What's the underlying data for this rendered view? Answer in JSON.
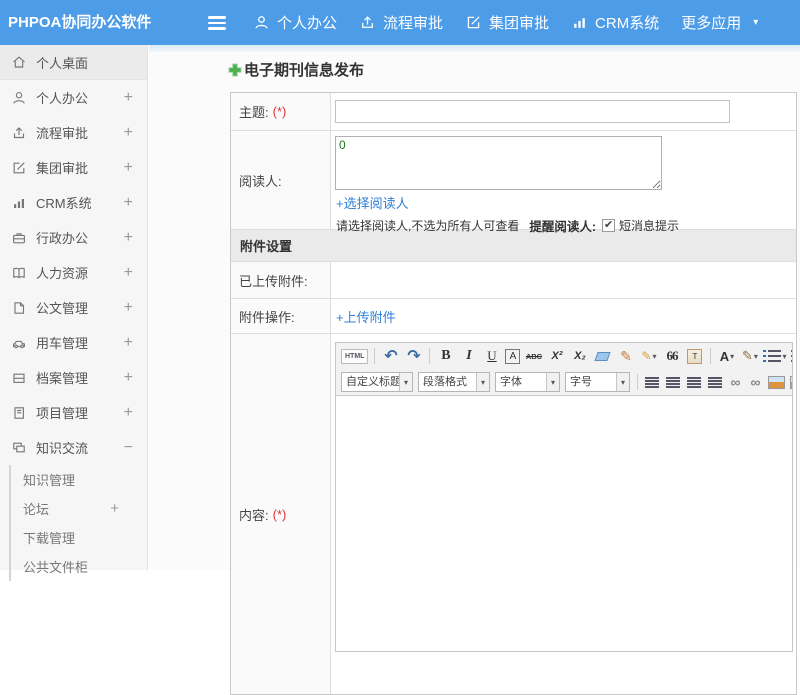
{
  "header": {
    "brand": "PHPOA协同办公软件",
    "nav": [
      {
        "label": "个人办公"
      },
      {
        "label": "流程审批"
      },
      {
        "label": "集团审批"
      },
      {
        "label": "CRM系统"
      },
      {
        "label": "更多应用"
      }
    ],
    "caret": "▾"
  },
  "sidebar": {
    "items": [
      {
        "label": "个人桌面",
        "expander": ""
      },
      {
        "label": "个人办公",
        "expander": "+"
      },
      {
        "label": "流程审批",
        "expander": "+"
      },
      {
        "label": "集团审批",
        "expander": "+"
      },
      {
        "label": "CRM系统",
        "expander": "+"
      },
      {
        "label": "行政办公",
        "expander": "+"
      },
      {
        "label": "人力资源",
        "expander": "+"
      },
      {
        "label": "公文管理",
        "expander": "+"
      },
      {
        "label": "用车管理",
        "expander": "+"
      },
      {
        "label": "档案管理",
        "expander": "+"
      },
      {
        "label": "项目管理",
        "expander": "+"
      },
      {
        "label": "知识交流",
        "expander": "−"
      }
    ],
    "subitems": [
      {
        "label": "知识管理",
        "expander": ""
      },
      {
        "label": "论坛",
        "expander": "+"
      },
      {
        "label": "下载管理",
        "expander": ""
      },
      {
        "label": "公共文件柜",
        "expander": ""
      }
    ]
  },
  "form": {
    "title": "电子期刊信息发布",
    "subject_label": "主题:",
    "required_mark": "(*)",
    "readers_label": "阅读人:",
    "readers_value": "0",
    "select_readers_link": "+选择阅读人",
    "readers_note": "请选择阅读人,不选为所有人可查看",
    "remind_label": "提醒阅读人:",
    "sms_label": "短消息提示",
    "attach_section": "附件设置",
    "uploaded_label": "已上传附件:",
    "attach_op_label": "附件操作:",
    "upload_link": "+上传附件",
    "content_label": "内容:"
  },
  "editor": {
    "html_label": "HTML",
    "undo_glyph": "↶",
    "redo_glyph": "↷",
    "bold": "B",
    "italic": "I",
    "underline": "U",
    "font_box": "A",
    "strike": "ABC",
    "sup": "X²",
    "sub": "X₂",
    "brush_glyph": "✎",
    "wand_glyph": "✎",
    "quote": "66",
    "clipboard_t": "T",
    "forecolor": "A",
    "pen_glyph": "✎",
    "chain_glyph": "∞",
    "caret": "▾",
    "selects": [
      {
        "label": "自定义标题"
      },
      {
        "label": "段落格式"
      },
      {
        "label": "字体"
      },
      {
        "label": "字号"
      }
    ]
  },
  "colors": {
    "header_blue": "#4d9ce8",
    "link_blue": "#2e7fd6",
    "required_red": "#e23333",
    "plus_green": "#44b04a"
  }
}
